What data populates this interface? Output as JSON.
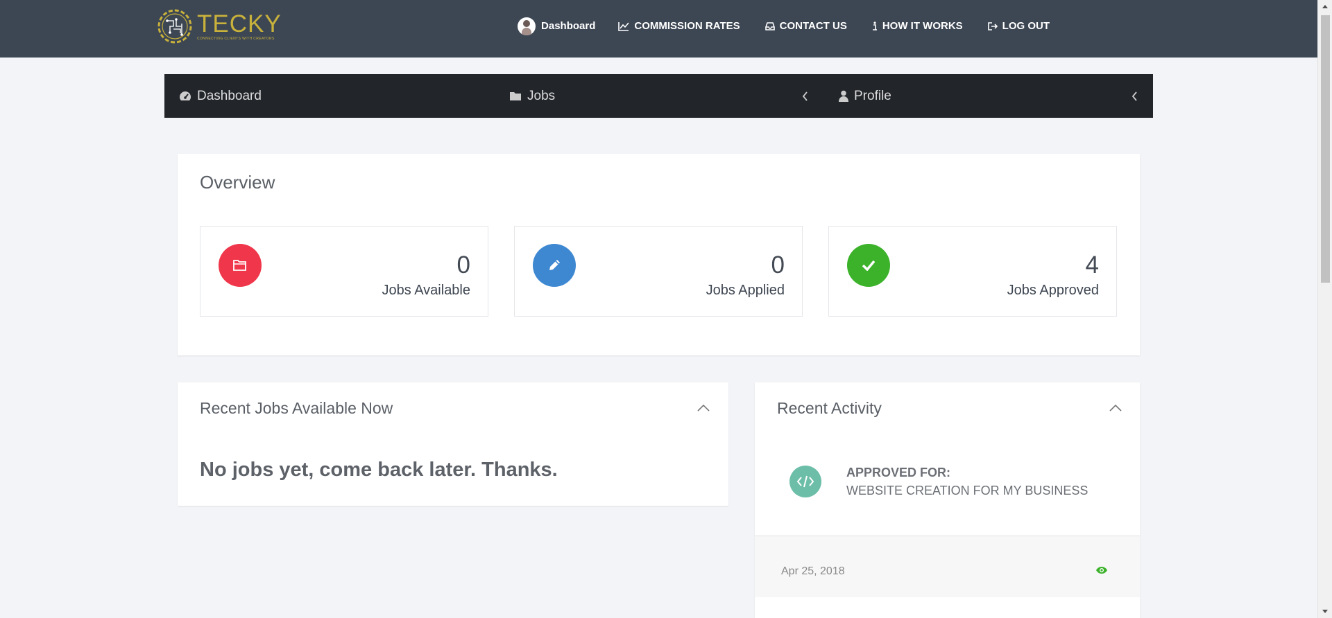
{
  "brand": {
    "name": "TECKY",
    "tagline": "CONNECTING CLIENTS WITH CREATORS",
    "color": "#c8b23c"
  },
  "topnav": {
    "items": [
      {
        "label": "Dashboard",
        "icon": "avatar"
      },
      {
        "label": "COMMISSION RATES",
        "icon": "line-chart-icon"
      },
      {
        "label": "CONTACT US",
        "icon": "inbox-icon"
      },
      {
        "label": "HOW IT WORKS",
        "icon": "info-icon"
      },
      {
        "label": "LOG OUT",
        "icon": "sign-out-icon"
      }
    ]
  },
  "subnav": {
    "items": [
      {
        "label": "Dashboard",
        "icon": "dashboard-icon"
      },
      {
        "label": "Jobs",
        "icon": "folder-icon"
      },
      {
        "label": "Profile",
        "icon": "user-icon"
      }
    ]
  },
  "overview": {
    "title": "Overview",
    "stats": [
      {
        "value": "0",
        "label": "Jobs Available",
        "color": "#f0364b",
        "icon": "folder-open-icon"
      },
      {
        "value": "0",
        "label": "Jobs Applied",
        "color": "#3e88d2",
        "icon": "pencil-icon"
      },
      {
        "value": "4",
        "label": "Jobs Approved",
        "color": "#3bb22a",
        "icon": "check-icon"
      }
    ]
  },
  "recent_jobs": {
    "title": "Recent Jobs Available Now",
    "empty_message": "No jobs yet, come back later. Thanks."
  },
  "activity": {
    "title": "Recent Activity",
    "items": [
      {
        "heading": "APPROVED FOR:",
        "text": "WEBSITE CREATION FOR MY BUSINESS",
        "date": "Apr 25, 2018",
        "icon": "code-icon",
        "icon_color": "#6dbea8"
      }
    ]
  },
  "colors": {
    "header": "#3d4653",
    "subnav": "#22252a",
    "background": "#f3f4f7",
    "eye": "#3bb22a"
  }
}
